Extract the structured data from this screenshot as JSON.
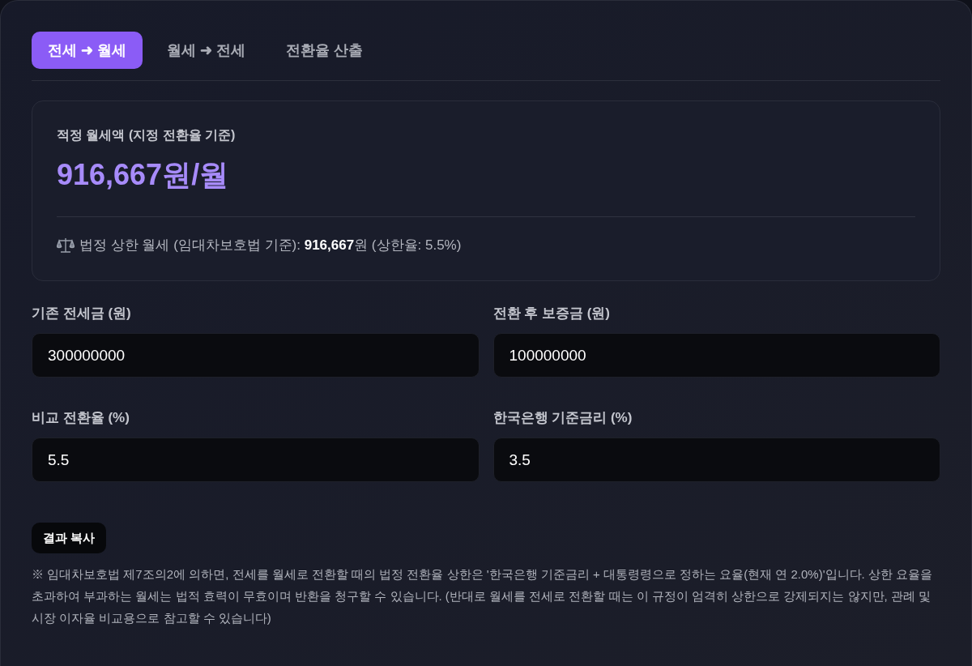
{
  "tabs": [
    {
      "label": "전세 ➜ 월세",
      "selected": true
    },
    {
      "label": "월세 ➜ 전세",
      "selected": false
    },
    {
      "label": "전환율 산출",
      "selected": false
    }
  ],
  "result": {
    "label": "적정 월세액 (지정 전환율 기준)",
    "value": "916,667원/월",
    "legal_note": "법정 상한 월세 (임대차보호법 기준): **916,667**원 (상한율: 5.5%)"
  },
  "fields": [
    {
      "label": "기존 전세금 (원)",
      "value": "300000000"
    },
    {
      "label": "전환 후 보증금 (원)",
      "value": "100000000"
    },
    {
      "label": "비교 전환율 (%)",
      "value": "5.5"
    },
    {
      "label": "한국은행 기준금리 (%)",
      "value": "3.5"
    }
  ],
  "copy_button": {
    "label": "결과 복사"
  },
  "footnote": "※ 임대차보호법 제7조의2에 의하면, 전세를 월세로 전환할 때의 법정 전환율 상한은 '한국은행 기준금리 + 대통령령으로 정하는 요율(현재 연 2.0%)'입니다. 상한 요율을 초과하여 부과하는 월세는 법적 효력이 무효이며 반환을 청구할 수 있습니다. (반대로 월세를 전세로 전환할 때는 이 규정이 엄격히 상한으로 강제되지는 않지만, 관례 및 시장 이자율 비교용으로 참고할 수 있습니다)"
}
